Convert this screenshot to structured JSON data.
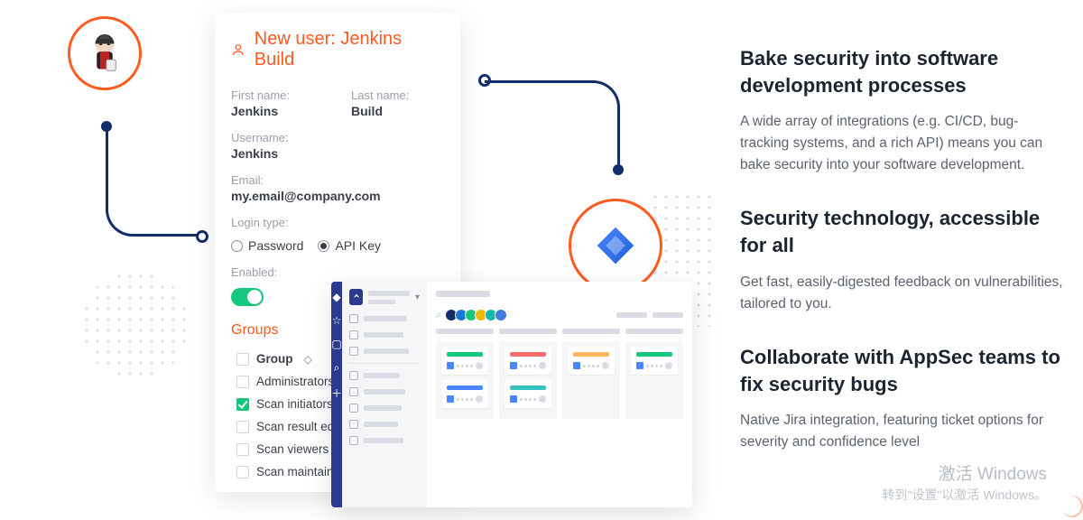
{
  "user_form": {
    "title": "New user: Jenkins Build",
    "first_name_label": "First name:",
    "first_name": "Jenkins",
    "last_name_label": "Last name:",
    "last_name": "Build",
    "username_label": "Username:",
    "username": "Jenkins",
    "email_label": "Email:",
    "email": "my.email@company.com",
    "login_type_label": "Login type:",
    "login_options": {
      "password": "Password",
      "api_key": "API Key",
      "selected": "api_key"
    },
    "enabled_label": "Enabled:",
    "enabled": true,
    "groups_heading": "Groups",
    "groups_header": "Group",
    "groups": [
      {
        "name": "Administrators",
        "checked": false
      },
      {
        "name": "Scan initiators",
        "checked": true
      },
      {
        "name": "Scan result editors",
        "checked": false
      },
      {
        "name": "Scan viewers",
        "checked": false
      },
      {
        "name": "Scan maintainers",
        "checked": false
      }
    ]
  },
  "integrations": {
    "jenkins_icon": "jenkins-icon",
    "jira_icon": "jira-icon"
  },
  "avatar_colors": [
    "#122d6b",
    "#1b77d6",
    "#14c77c",
    "#f2b90c",
    "#14b8a6",
    "#3f7dd9"
  ],
  "card_colors": {
    "red": "#ff6b6b",
    "green": "#14c77c",
    "orange": "#ffb65c",
    "blue": "#4a86ff",
    "teal": "#35c3c1"
  },
  "marketing": {
    "section1_title": "Bake security into software development processes",
    "section1_body": "A wide array of integrations (e.g. CI/CD, bug-tracking systems, and a rich API) means you can bake security into your software development.",
    "section2_title": "Security technology, accessible for all",
    "section2_body": "Get fast, easily-digested feedback on vulnerabilities, tailored to you.",
    "section3_title": "Collaborate with AppSec teams to fix security bugs",
    "section3_body": "Native Jira integration, featuring ticket options for severity and confidence level"
  },
  "watermark": {
    "line1": "激活 Windows",
    "line2": "转到\"设置\"以激活 Windows。"
  }
}
